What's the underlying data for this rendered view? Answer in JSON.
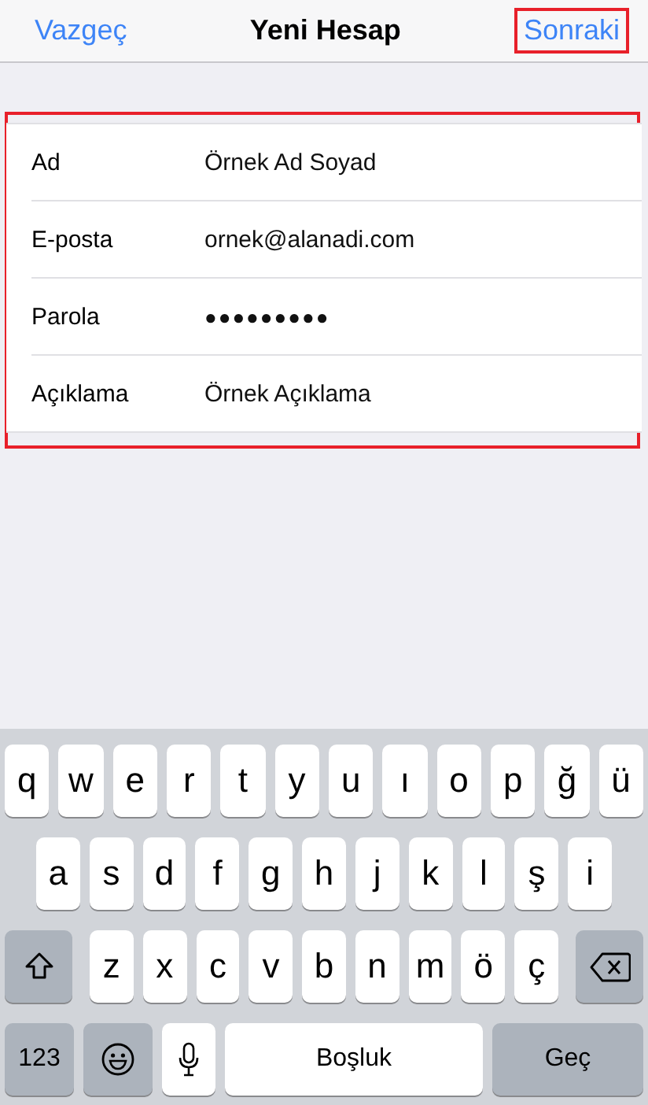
{
  "nav_bar": {
    "cancel": "Vazgeç",
    "title": "Yeni Hesap",
    "next": {
      "label": "Sonraki",
      "highlighted": true
    }
  },
  "form": {
    "highlighted": true,
    "rows": [
      {
        "label": "Ad",
        "value": "Örnek Ad Soyad",
        "kind": "text"
      },
      {
        "label": "E-posta",
        "value": "ornek@alanadi.com",
        "kind": "text"
      },
      {
        "label": "Parola",
        "value": "●●●●●●●●●",
        "kind": "password"
      },
      {
        "label": "Açıklama",
        "value": "Örnek Açıklama",
        "kind": "text"
      }
    ]
  },
  "keyboard": {
    "rows": [
      {
        "keys": [
          {
            "kind": "letter",
            "label": "q"
          },
          {
            "kind": "letter",
            "label": "w"
          },
          {
            "kind": "letter",
            "label": "e"
          },
          {
            "kind": "letter",
            "label": "r"
          },
          {
            "kind": "letter",
            "label": "t"
          },
          {
            "kind": "letter",
            "label": "y"
          },
          {
            "kind": "letter",
            "label": "u"
          },
          {
            "kind": "letter",
            "label": "ı"
          },
          {
            "kind": "letter",
            "label": "o"
          },
          {
            "kind": "letter",
            "label": "p"
          },
          {
            "kind": "letter",
            "label": "ğ"
          },
          {
            "kind": "letter",
            "label": "ü"
          }
        ]
      },
      {
        "keys": [
          {
            "kind": "letter",
            "label": "a"
          },
          {
            "kind": "letter",
            "label": "s"
          },
          {
            "kind": "letter",
            "label": "d"
          },
          {
            "kind": "letter",
            "label": "f"
          },
          {
            "kind": "letter",
            "label": "g"
          },
          {
            "kind": "letter",
            "label": "h"
          },
          {
            "kind": "letter",
            "label": "j"
          },
          {
            "kind": "letter",
            "label": "k"
          },
          {
            "kind": "letter",
            "label": "l"
          },
          {
            "kind": "letter",
            "label": "ş"
          },
          {
            "kind": "letter",
            "label": "i"
          }
        ]
      },
      {
        "keys": [
          {
            "kind": "shift"
          },
          {
            "kind": "letter",
            "label": "z"
          },
          {
            "kind": "letter",
            "label": "x"
          },
          {
            "kind": "letter",
            "label": "c"
          },
          {
            "kind": "letter",
            "label": "v"
          },
          {
            "kind": "letter",
            "label": "b"
          },
          {
            "kind": "letter",
            "label": "n"
          },
          {
            "kind": "letter",
            "label": "m"
          },
          {
            "kind": "letter",
            "label": "ö"
          },
          {
            "kind": "letter",
            "label": "ç"
          },
          {
            "kind": "delete"
          }
        ]
      },
      {
        "keys": [
          {
            "kind": "numbers",
            "label": "123"
          },
          {
            "kind": "emoji"
          },
          {
            "kind": "mic"
          },
          {
            "kind": "space",
            "label": "Boşluk"
          },
          {
            "kind": "return",
            "label": "Geç"
          }
        ]
      }
    ]
  }
}
